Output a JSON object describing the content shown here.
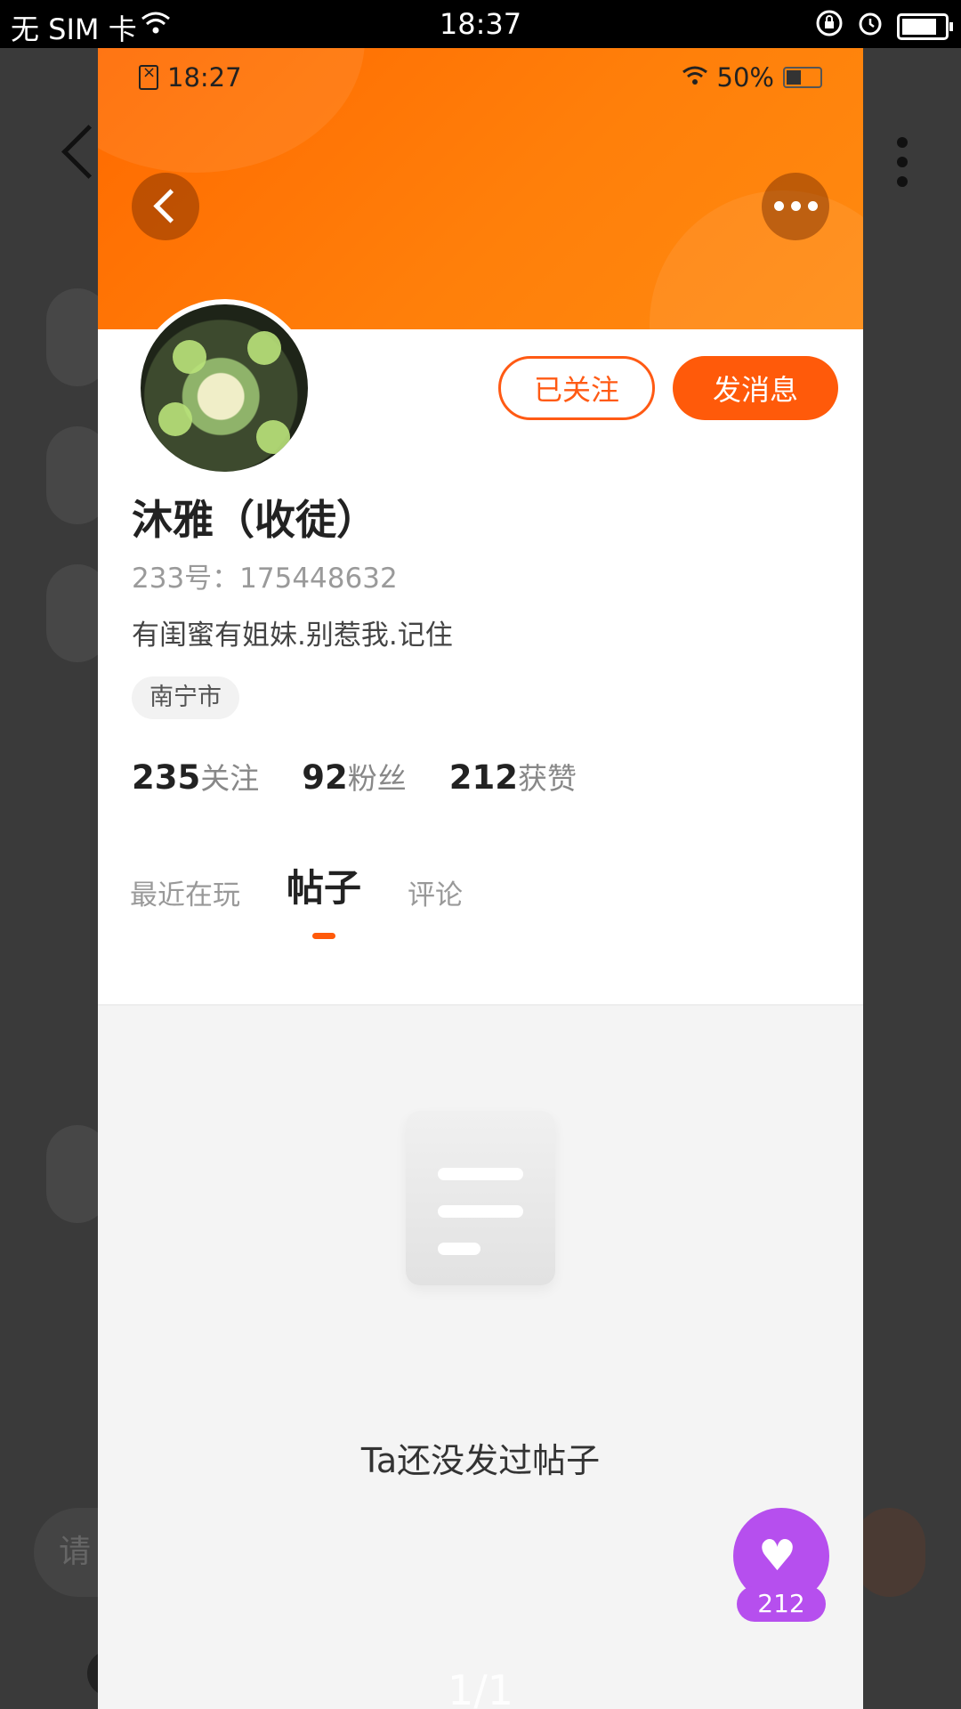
{
  "os_status": {
    "carrier": "无 SIM 卡",
    "time": "18:37"
  },
  "inner_status": {
    "time": "18:27",
    "battery": "50%"
  },
  "profile": {
    "follow_label": "已关注",
    "message_label": "发消息",
    "name": "沐雅（收徒）",
    "uid": "233号：175448632",
    "bio": "有闺蜜有姐妹.别惹我.记住",
    "city": "南宁市",
    "stats": {
      "following_count": "235",
      "following_label": "关注",
      "fans_count": "92",
      "fans_label": "粉丝",
      "likes_count": "212",
      "likes_label": "获赞"
    },
    "tabs": [
      {
        "label": "最近在玩"
      },
      {
        "label": "帖子"
      },
      {
        "label": "评论"
      }
    ]
  },
  "empty_state": {
    "text": "Ta还没发过帖子"
  },
  "like_badge": {
    "count": "212"
  },
  "pager": "1/1",
  "background": {
    "input_placeholder": "请"
  },
  "colors": {
    "accent": "#ff5a0a",
    "banner": "#ff7a00",
    "like": "#b64fee"
  }
}
